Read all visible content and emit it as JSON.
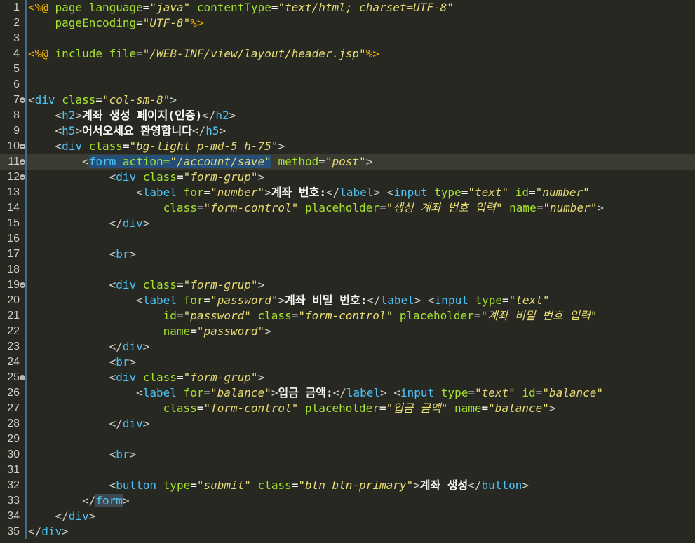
{
  "editor": {
    "lines": [
      {
        "n": "1",
        "fold": false,
        "tokens": [
          [
            "d",
            "<%@"
          ],
          [
            "s",
            " "
          ],
          [
            "a",
            "page"
          ],
          [
            "s",
            " "
          ],
          [
            "a",
            "language"
          ],
          [
            "p",
            "="
          ],
          [
            "v",
            "\"java\""
          ],
          [
            "s",
            " "
          ],
          [
            "a",
            "contentType"
          ],
          [
            "p",
            "="
          ],
          [
            "v",
            "\"text/html; charset=UTF-8\""
          ]
        ]
      },
      {
        "n": "2",
        "fold": false,
        "tokens": [
          [
            "s",
            "    "
          ],
          [
            "a",
            "pageEncoding"
          ],
          [
            "p",
            "="
          ],
          [
            "v",
            "\"UTF-8\""
          ],
          [
            "d",
            "%>"
          ]
        ]
      },
      {
        "n": "3",
        "fold": false,
        "tokens": []
      },
      {
        "n": "4",
        "fold": false,
        "tokens": [
          [
            "d",
            "<%@"
          ],
          [
            "s",
            " "
          ],
          [
            "a",
            "include"
          ],
          [
            "s",
            " "
          ],
          [
            "a",
            "file"
          ],
          [
            "p",
            "="
          ],
          [
            "v",
            "\"/WEB-INF/view/layout/header.jsp\""
          ],
          [
            "d",
            "%>"
          ]
        ]
      },
      {
        "n": "5",
        "fold": false,
        "tokens": []
      },
      {
        "n": "6",
        "fold": false,
        "tokens": []
      },
      {
        "n": "7",
        "fold": true,
        "tokens": [
          [
            "b",
            "<"
          ],
          [
            "g",
            "div"
          ],
          [
            "s",
            " "
          ],
          [
            "a",
            "class"
          ],
          [
            "p",
            "="
          ],
          [
            "v",
            "\"col-sm-8\""
          ],
          [
            "b",
            ">"
          ]
        ]
      },
      {
        "n": "8",
        "fold": false,
        "tokens": [
          [
            "s",
            "    "
          ],
          [
            "b",
            "<"
          ],
          [
            "g",
            "h2"
          ],
          [
            "b",
            ">"
          ],
          [
            "t",
            "계좌 생성 페이지(인증)"
          ],
          [
            "b",
            "</"
          ],
          [
            "g",
            "h2"
          ],
          [
            "b",
            ">"
          ]
        ]
      },
      {
        "n": "9",
        "fold": false,
        "tokens": [
          [
            "s",
            "    "
          ],
          [
            "b",
            "<"
          ],
          [
            "g",
            "h5"
          ],
          [
            "b",
            ">"
          ],
          [
            "t",
            "어서오세요 환영합니다"
          ],
          [
            "b",
            "</"
          ],
          [
            "g",
            "h5"
          ],
          [
            "b",
            ">"
          ]
        ]
      },
      {
        "n": "10",
        "fold": true,
        "tokens": [
          [
            "s",
            "    "
          ],
          [
            "b",
            "<"
          ],
          [
            "g",
            "div"
          ],
          [
            "s",
            " "
          ],
          [
            "a",
            "class"
          ],
          [
            "p",
            "="
          ],
          [
            "v",
            "\"bg-light p-md-5 h-75\""
          ],
          [
            "b",
            ">"
          ]
        ]
      },
      {
        "n": "11",
        "fold": true,
        "current": true,
        "tokens": [
          [
            "s",
            "        "
          ],
          [
            "b",
            "<"
          ],
          [
            "G",
            "form"
          ],
          [
            "X",
            " "
          ],
          [
            "X",
            "action"
          ],
          [
            "X",
            "="
          ],
          [
            "Y",
            "\"/account/save\""
          ],
          [
            "s",
            " "
          ],
          [
            "a",
            "method"
          ],
          [
            "p",
            "="
          ],
          [
            "v",
            "\"post\""
          ],
          [
            "b",
            ">"
          ]
        ]
      },
      {
        "n": "12",
        "fold": true,
        "tokens": [
          [
            "s",
            "            "
          ],
          [
            "b",
            "<"
          ],
          [
            "g",
            "div"
          ],
          [
            "s",
            " "
          ],
          [
            "a",
            "class"
          ],
          [
            "p",
            "="
          ],
          [
            "v",
            "\"form-grup\""
          ],
          [
            "b",
            ">"
          ]
        ]
      },
      {
        "n": "13",
        "fold": false,
        "tokens": [
          [
            "s",
            "                "
          ],
          [
            "b",
            "<"
          ],
          [
            "g",
            "label"
          ],
          [
            "s",
            " "
          ],
          [
            "a",
            "for"
          ],
          [
            "p",
            "="
          ],
          [
            "v",
            "\"number\""
          ],
          [
            "b",
            ">"
          ],
          [
            "t",
            "계좌 번호:"
          ],
          [
            "b",
            "</"
          ],
          [
            "g",
            "label"
          ],
          [
            "b",
            ">"
          ],
          [
            "s",
            " "
          ],
          [
            "b",
            "<"
          ],
          [
            "g",
            "input"
          ],
          [
            "s",
            " "
          ],
          [
            "a",
            "type"
          ],
          [
            "p",
            "="
          ],
          [
            "v",
            "\"text\""
          ],
          [
            "s",
            " "
          ],
          [
            "a",
            "id"
          ],
          [
            "p",
            "="
          ],
          [
            "v",
            "\"number\""
          ]
        ]
      },
      {
        "n": "14",
        "fold": false,
        "tokens": [
          [
            "s",
            "                    "
          ],
          [
            "a",
            "class"
          ],
          [
            "p",
            "="
          ],
          [
            "v",
            "\"form-control\""
          ],
          [
            "s",
            " "
          ],
          [
            "a",
            "placeholder"
          ],
          [
            "p",
            "="
          ],
          [
            "v",
            "\"생성 계좌 번호 입력\""
          ],
          [
            "s",
            " "
          ],
          [
            "a",
            "name"
          ],
          [
            "p",
            "="
          ],
          [
            "v",
            "\"number\""
          ],
          [
            "b",
            ">"
          ]
        ]
      },
      {
        "n": "15",
        "fold": false,
        "tokens": [
          [
            "s",
            "            "
          ],
          [
            "b",
            "</"
          ],
          [
            "g",
            "div"
          ],
          [
            "b",
            ">"
          ]
        ]
      },
      {
        "n": "16",
        "fold": false,
        "tokens": []
      },
      {
        "n": "17",
        "fold": false,
        "tokens": [
          [
            "s",
            "            "
          ],
          [
            "b",
            "<"
          ],
          [
            "g",
            "br"
          ],
          [
            "b",
            ">"
          ]
        ]
      },
      {
        "n": "18",
        "fold": false,
        "tokens": []
      },
      {
        "n": "19",
        "fold": true,
        "tokens": [
          [
            "s",
            "            "
          ],
          [
            "b",
            "<"
          ],
          [
            "g",
            "div"
          ],
          [
            "s",
            " "
          ],
          [
            "a",
            "class"
          ],
          [
            "p",
            "="
          ],
          [
            "v",
            "\"form-grup\""
          ],
          [
            "b",
            ">"
          ]
        ]
      },
      {
        "n": "20",
        "fold": false,
        "tokens": [
          [
            "s",
            "                "
          ],
          [
            "b",
            "<"
          ],
          [
            "g",
            "label"
          ],
          [
            "s",
            " "
          ],
          [
            "a",
            "for"
          ],
          [
            "p",
            "="
          ],
          [
            "v",
            "\"password\""
          ],
          [
            "b",
            ">"
          ],
          [
            "t",
            "계좌 비밀 번호:"
          ],
          [
            "b",
            "</"
          ],
          [
            "g",
            "label"
          ],
          [
            "b",
            ">"
          ],
          [
            "s",
            " "
          ],
          [
            "b",
            "<"
          ],
          [
            "g",
            "input"
          ],
          [
            "s",
            " "
          ],
          [
            "a",
            "type"
          ],
          [
            "p",
            "="
          ],
          [
            "v",
            "\"text\""
          ]
        ]
      },
      {
        "n": "21",
        "fold": false,
        "tokens": [
          [
            "s",
            "                    "
          ],
          [
            "a",
            "id"
          ],
          [
            "p",
            "="
          ],
          [
            "v",
            "\"password\""
          ],
          [
            "s",
            " "
          ],
          [
            "a",
            "class"
          ],
          [
            "p",
            "="
          ],
          [
            "v",
            "\"form-control\""
          ],
          [
            "s",
            " "
          ],
          [
            "a",
            "placeholder"
          ],
          [
            "p",
            "="
          ],
          [
            "v",
            "\"계좌 비밀 번호 입력\""
          ]
        ]
      },
      {
        "n": "22",
        "fold": false,
        "tokens": [
          [
            "s",
            "                    "
          ],
          [
            "a",
            "name"
          ],
          [
            "p",
            "="
          ],
          [
            "v",
            "\"password\""
          ],
          [
            "b",
            ">"
          ]
        ]
      },
      {
        "n": "23",
        "fold": false,
        "tokens": [
          [
            "s",
            "            "
          ],
          [
            "b",
            "</"
          ],
          [
            "g",
            "div"
          ],
          [
            "b",
            ">"
          ]
        ]
      },
      {
        "n": "24",
        "fold": false,
        "tokens": [
          [
            "s",
            "            "
          ],
          [
            "b",
            "<"
          ],
          [
            "g",
            "br"
          ],
          [
            "b",
            ">"
          ]
        ]
      },
      {
        "n": "25",
        "fold": true,
        "tokens": [
          [
            "s",
            "            "
          ],
          [
            "b",
            "<"
          ],
          [
            "g",
            "div"
          ],
          [
            "s",
            " "
          ],
          [
            "a",
            "class"
          ],
          [
            "p",
            "="
          ],
          [
            "v",
            "\"form-grup\""
          ],
          [
            "b",
            ">"
          ]
        ]
      },
      {
        "n": "26",
        "fold": false,
        "tokens": [
          [
            "s",
            "                "
          ],
          [
            "b",
            "<"
          ],
          [
            "g",
            "label"
          ],
          [
            "s",
            " "
          ],
          [
            "a",
            "for"
          ],
          [
            "p",
            "="
          ],
          [
            "v",
            "\"balance\""
          ],
          [
            "b",
            ">"
          ],
          [
            "t",
            "입금 금액:"
          ],
          [
            "b",
            "</"
          ],
          [
            "g",
            "label"
          ],
          [
            "b",
            ">"
          ],
          [
            "s",
            " "
          ],
          [
            "b",
            "<"
          ],
          [
            "g",
            "input"
          ],
          [
            "s",
            " "
          ],
          [
            "a",
            "type"
          ],
          [
            "p",
            "="
          ],
          [
            "v",
            "\"text\""
          ],
          [
            "s",
            " "
          ],
          [
            "a",
            "id"
          ],
          [
            "p",
            "="
          ],
          [
            "v",
            "\"balance\""
          ]
        ]
      },
      {
        "n": "27",
        "fold": false,
        "tokens": [
          [
            "s",
            "                    "
          ],
          [
            "a",
            "class"
          ],
          [
            "p",
            "="
          ],
          [
            "v",
            "\"form-control\""
          ],
          [
            "s",
            " "
          ],
          [
            "a",
            "placeholder"
          ],
          [
            "p",
            "="
          ],
          [
            "v",
            "\"입금 금액\""
          ],
          [
            "s",
            " "
          ],
          [
            "a",
            "name"
          ],
          [
            "p",
            "="
          ],
          [
            "v",
            "\"balance\""
          ],
          [
            "b",
            ">"
          ]
        ]
      },
      {
        "n": "28",
        "fold": false,
        "tokens": [
          [
            "s",
            "            "
          ],
          [
            "b",
            "</"
          ],
          [
            "g",
            "div"
          ],
          [
            "b",
            ">"
          ]
        ]
      },
      {
        "n": "29",
        "fold": false,
        "tokens": []
      },
      {
        "n": "30",
        "fold": false,
        "tokens": [
          [
            "s",
            "            "
          ],
          [
            "b",
            "<"
          ],
          [
            "g",
            "br"
          ],
          [
            "b",
            ">"
          ]
        ]
      },
      {
        "n": "31",
        "fold": false,
        "tokens": []
      },
      {
        "n": "32",
        "fold": false,
        "tokens": [
          [
            "s",
            "            "
          ],
          [
            "b",
            "<"
          ],
          [
            "g",
            "button"
          ],
          [
            "s",
            " "
          ],
          [
            "a",
            "type"
          ],
          [
            "p",
            "="
          ],
          [
            "v",
            "\"submit\""
          ],
          [
            "s",
            " "
          ],
          [
            "a",
            "class"
          ],
          [
            "p",
            "="
          ],
          [
            "v",
            "\"btn btn-primary\""
          ],
          [
            "b",
            ">"
          ],
          [
            "t",
            "계좌 생성"
          ],
          [
            "b",
            "</"
          ],
          [
            "g",
            "button"
          ],
          [
            "b",
            ">"
          ]
        ]
      },
      {
        "n": "33",
        "fold": false,
        "tokens": [
          [
            "s",
            "        "
          ],
          [
            "b",
            "</"
          ],
          [
            "H",
            "form"
          ],
          [
            "b",
            ">"
          ]
        ]
      },
      {
        "n": "34",
        "fold": false,
        "tokens": [
          [
            "s",
            "    "
          ],
          [
            "b",
            "</"
          ],
          [
            "g",
            "div"
          ],
          [
            "b",
            ">"
          ]
        ]
      },
      {
        "n": "35",
        "fold": false,
        "tokens": [
          [
            "b",
            "</"
          ],
          [
            "g",
            "div"
          ],
          [
            "b",
            ">"
          ]
        ]
      }
    ],
    "colors": {
      "background": "#272822",
      "tag": "#4ec2f7",
      "attribute": "#a6e22e",
      "value": "#e6db74",
      "directive": "#f0b000",
      "selection": "#264f78"
    }
  }
}
